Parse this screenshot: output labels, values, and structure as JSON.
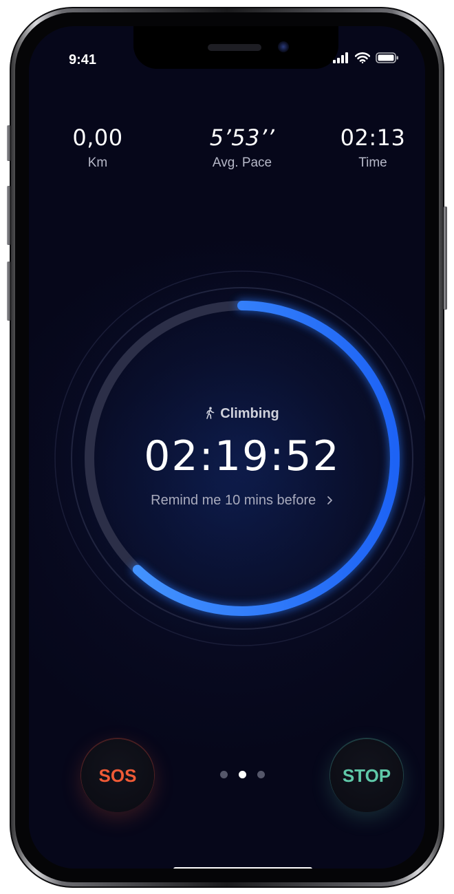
{
  "status_bar": {
    "time": "9:41",
    "icons": [
      "signal-icon",
      "wifi-icon",
      "battery-icon"
    ]
  },
  "stats": [
    {
      "value": "0,00",
      "label": "Km"
    },
    {
      "value": "5’53’’",
      "label": "Avg. Pace"
    },
    {
      "value": "02:13",
      "label": "Time"
    }
  ],
  "activity": {
    "icon": "walking-person-icon",
    "label": "Climbing"
  },
  "timer": {
    "value": "02:19:52",
    "progress": 0.62
  },
  "remind": {
    "label": "Remind me 10 mins before",
    "icon": "chevron-right-icon"
  },
  "buttons": {
    "sos_label": "SOS",
    "stop_label": "STOP"
  },
  "pager": {
    "count": 3,
    "active_index": 1
  },
  "colors": {
    "background": "#06071a",
    "accent_blue": "#2c7bff",
    "sos_red": "#ef5a36",
    "stop_green": "#5fc8a8"
  }
}
